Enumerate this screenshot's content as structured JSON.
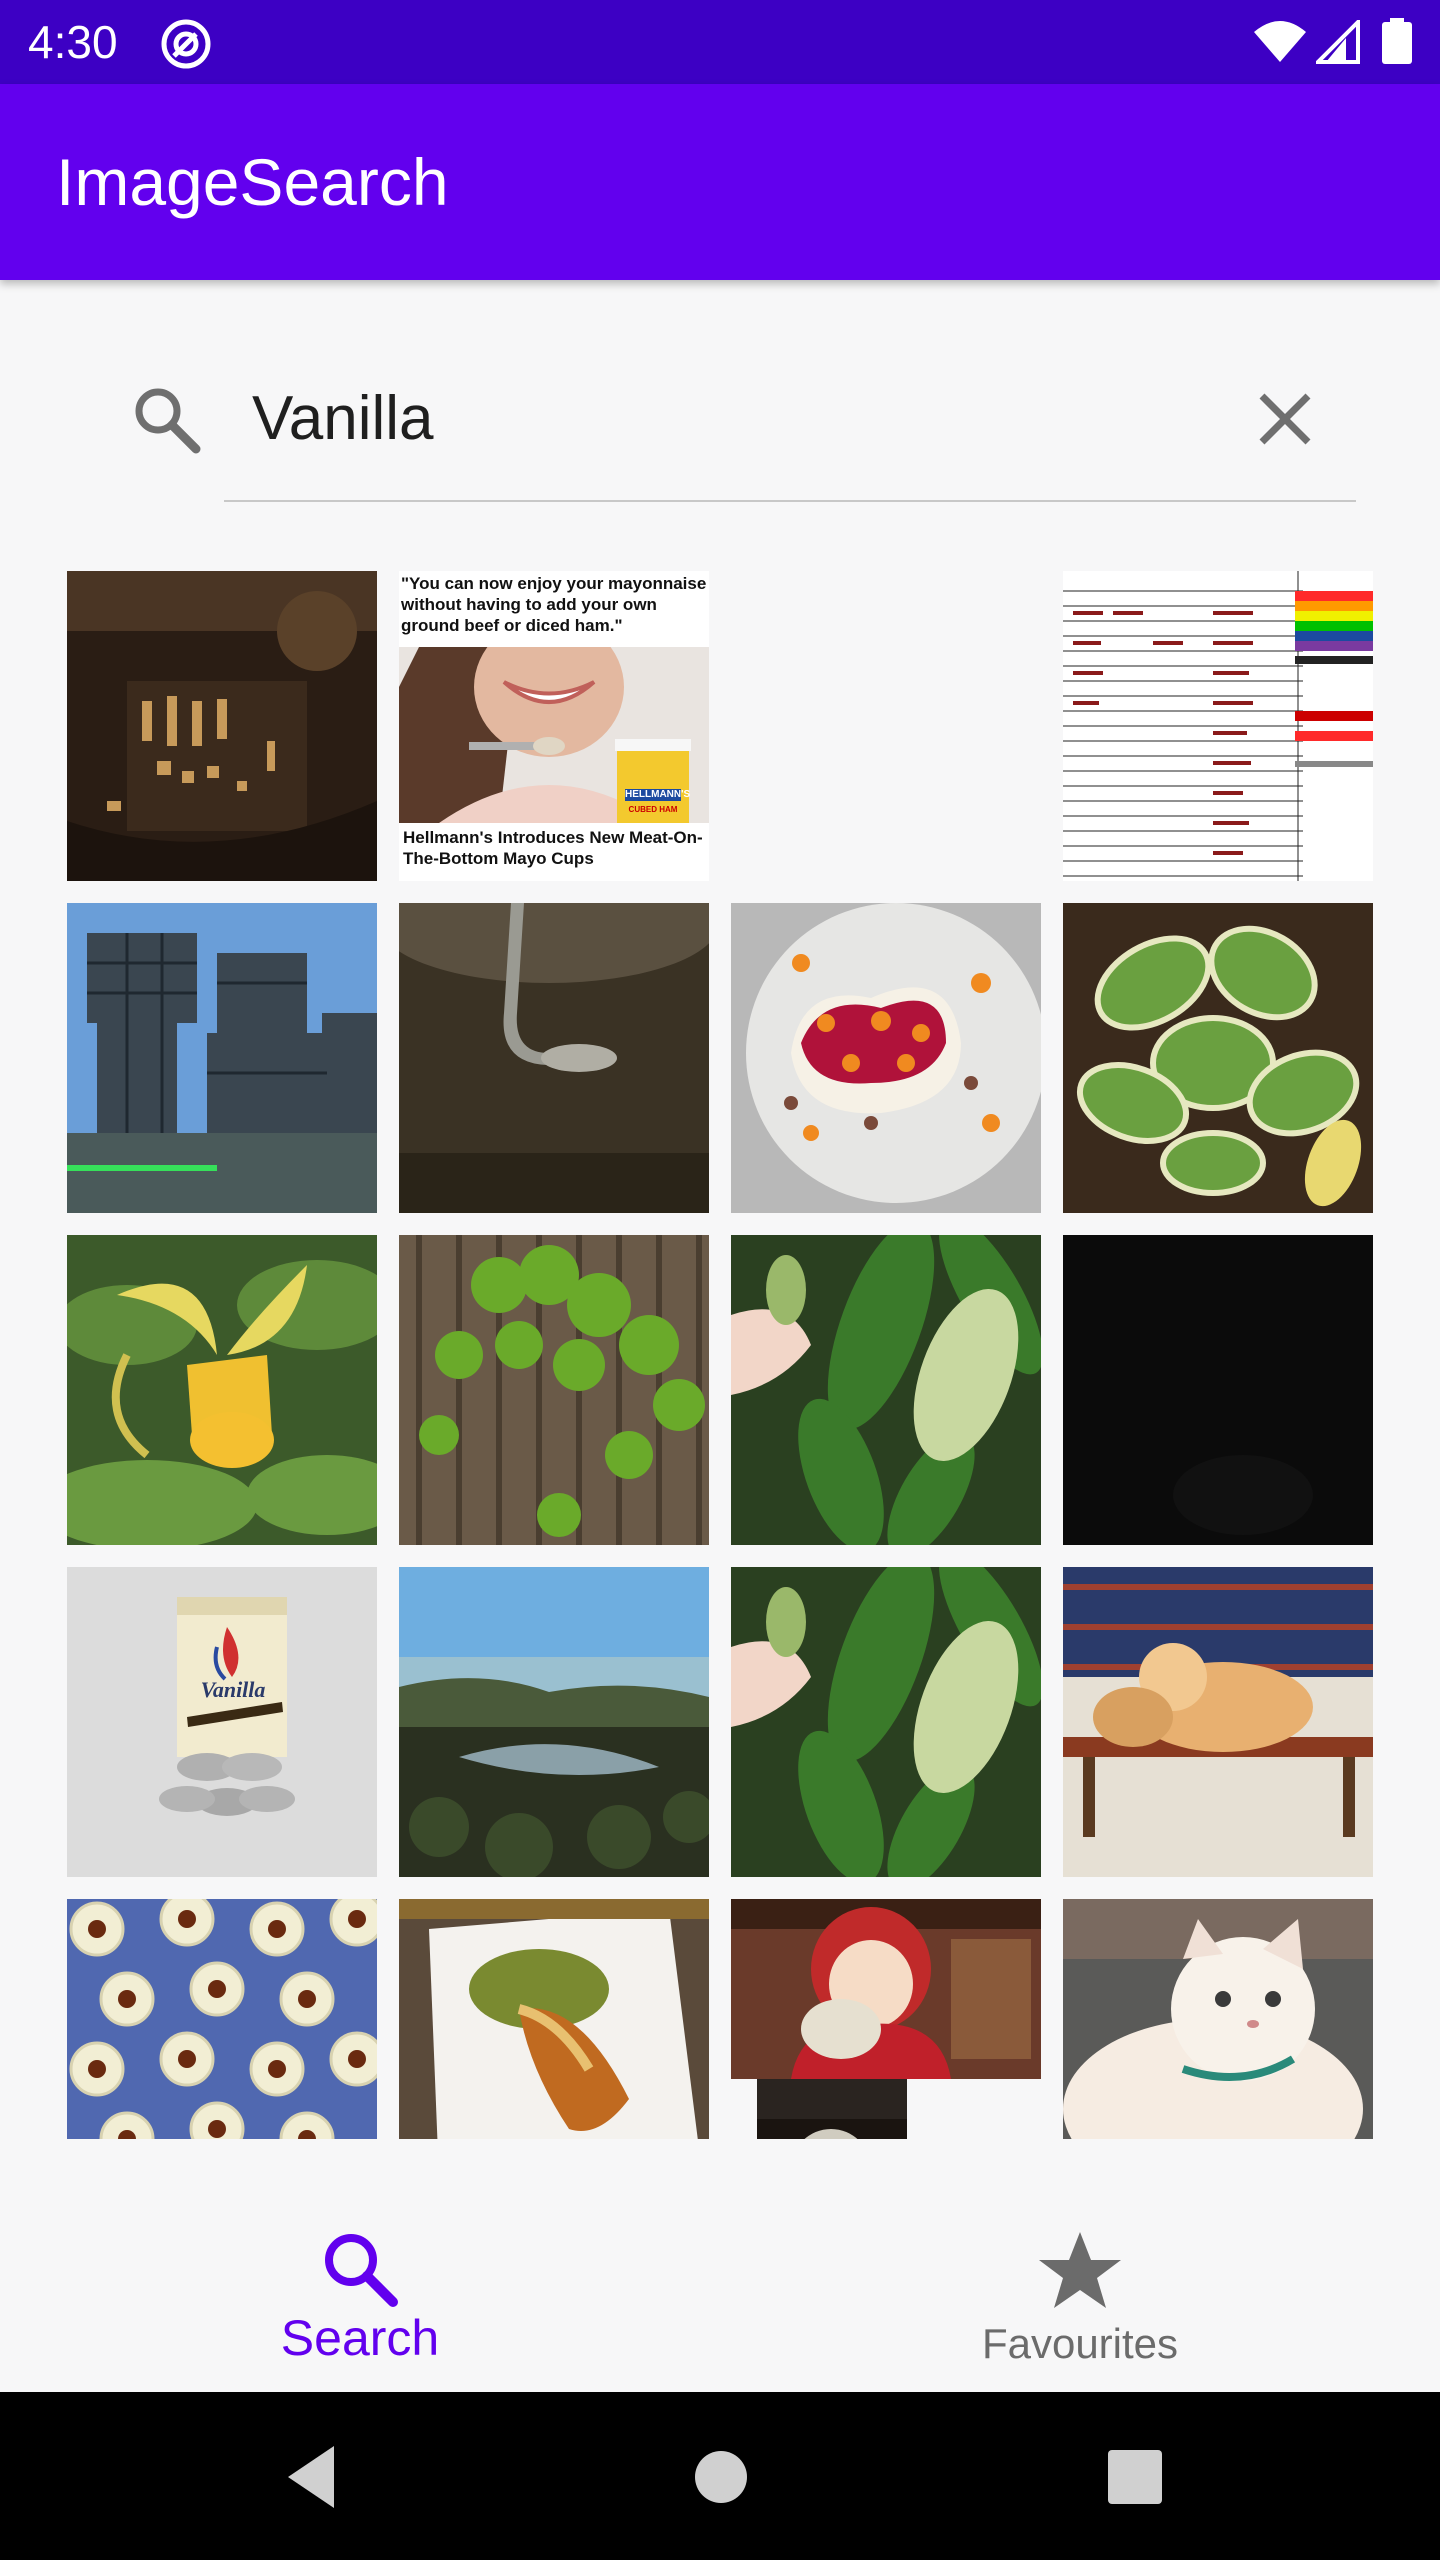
{
  "status_bar": {
    "time": "4:30",
    "app_icon": "at-sign-icon",
    "icons": [
      "wifi-icon",
      "signal-icon",
      "battery-icon"
    ]
  },
  "app_bar": {
    "title": "ImageSearch",
    "color": "#6200ee"
  },
  "search": {
    "icon": "search-icon",
    "value": "Vanilla",
    "clear_icon": "close-icon"
  },
  "results": [
    {
      "label": "aerial-night-scene"
    },
    {
      "label": "mayonnaise-ad",
      "caption_top": "\"You can now enjoy your mayonnaise without having to add your own ground beef or diced ham.\"",
      "caption_bottom": "Hellmann's Introduces New Meat-On-The-Bottom Mayo Cups",
      "product": "HELLMANN'S",
      "product_sub": "CUBED HAM"
    },
    {
      "label": "blank"
    },
    {
      "label": "spreadsheet"
    },
    {
      "label": "industrial-structure"
    },
    {
      "label": "spoon-in-pot"
    },
    {
      "label": "dessert-plate"
    },
    {
      "label": "variegated-plant"
    },
    {
      "label": "vanilla-orchid"
    },
    {
      "label": "vine-fence"
    },
    {
      "label": "hand-leaf"
    },
    {
      "label": "dark-image"
    },
    {
      "label": "vanilla-candles",
      "box_text": "Vanilla"
    },
    {
      "label": "landscape-lake"
    },
    {
      "label": "hand-leaf-2"
    },
    {
      "label": "dogs-bench"
    },
    {
      "label": "cupcake-liners"
    },
    {
      "label": "pastry-plate"
    },
    {
      "label": "anime-girl"
    },
    {
      "label": "kitten"
    }
  ],
  "bottom_nav": {
    "items": [
      {
        "label": "Search",
        "icon": "search-icon",
        "active": true
      },
      {
        "label": "Favourites",
        "icon": "star-icon",
        "active": false
      }
    ],
    "active_color": "#6200ee",
    "inactive_color": "#6b6b6b"
  },
  "system_nav": {
    "icons": [
      "back-icon",
      "home-icon",
      "recents-icon"
    ]
  }
}
